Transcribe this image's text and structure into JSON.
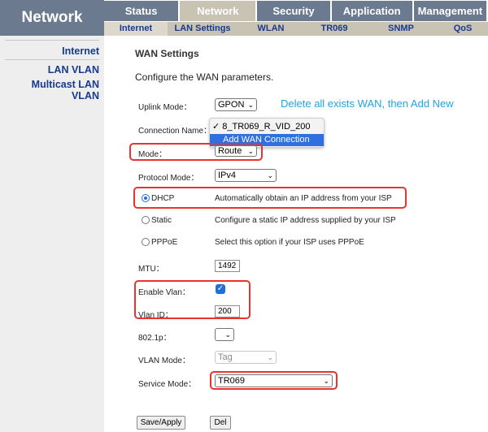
{
  "header": {
    "brand": "Network",
    "tabs": [
      "Status",
      "Network",
      "Security",
      "Application",
      "Management"
    ],
    "subtabs": [
      "Internet",
      "LAN Settings",
      "WLAN",
      "TR069",
      "SNMP",
      "QoS"
    ]
  },
  "sidebar": {
    "items": [
      "Internet",
      "LAN VLAN",
      "Multicast LAN VLAN"
    ]
  },
  "main": {
    "title": "WAN Settings",
    "description": "Configure the WAN parameters.",
    "annotation": "Delete all exists WAN,  then Add New",
    "uplink_mode_label": "Uplink Mode：",
    "uplink_mode_value": "GPON",
    "connection_name_label": "Connection Name：",
    "connection_options": [
      "8_TR069_R_VID_200",
      "Add WAN Connection"
    ],
    "mode_label": "Mode：",
    "mode_value": "Route",
    "protocol_mode_label": "Protocol Mode：",
    "protocol_mode_value": "IPv4",
    "dhcp_label": "DHCP",
    "dhcp_desc": "Automatically obtain an IP address from your ISP",
    "static_label": "Static",
    "static_desc": "Configure a static IP address supplied by your ISP",
    "pppoe_label": "PPPoE",
    "pppoe_desc": "Select this option if your ISP uses PPPoE",
    "mtu_label": "MTU：",
    "mtu_value": "1492",
    "enable_vlan_label": "Enable Vlan：",
    "enable_vlan_checked": true,
    "vlan_id_label": "Vlan ID：",
    "vlan_id_value": "200",
    "p8021_label": "802.1p：",
    "p8021_value": "",
    "vlan_mode_label": "VLAN Mode：",
    "vlan_mode_value": "Tag",
    "service_mode_label": "Service Mode：",
    "service_mode_value": "TR069",
    "save_button": "Save/Apply",
    "del_button": "Del"
  },
  "colors": {
    "header_bg": "#6b7a8f",
    "subnav_bg": "#c9c3b4",
    "link_blue": "#17398f",
    "annotation_blue": "#21a3e6",
    "highlight_red": "#e8332e",
    "checkbox_blue": "#1e6fd9"
  }
}
